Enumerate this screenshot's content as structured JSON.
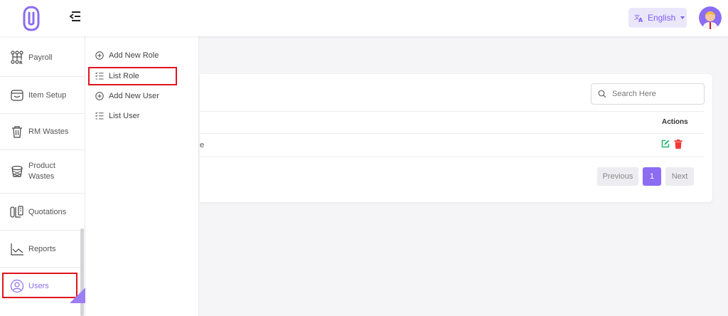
{
  "header": {
    "language": "English"
  },
  "sidebar": {
    "items": [
      {
        "label": "Payroll",
        "icon": "payroll-icon"
      },
      {
        "label": "Item Setup",
        "icon": "item-setup-icon"
      },
      {
        "label": "RM Wastes",
        "icon": "trash-icon"
      },
      {
        "label": "Product Wastes",
        "icon": "basket-icon"
      },
      {
        "label": "Quotations",
        "icon": "quotations-icon"
      },
      {
        "label": "Reports",
        "icon": "chart-icon"
      },
      {
        "label": "Users",
        "icon": "user-icon"
      }
    ]
  },
  "submenu": {
    "items": [
      {
        "label": "Add New Role",
        "icon": "plus-circle-icon"
      },
      {
        "label": "List Role",
        "icon": "list-icon"
      },
      {
        "label": "Add New User",
        "icon": "plus-circle-icon"
      },
      {
        "label": "List User",
        "icon": "list-icon"
      }
    ]
  },
  "table": {
    "search_placeholder": "Search Here",
    "actions_header": "Actions",
    "row_fragment": "e"
  },
  "pagination": {
    "previous": "Previous",
    "current": "1",
    "next": "Next"
  },
  "colors": {
    "accent": "#8b6cf2",
    "highlight_box": "#e0141e",
    "edit": "#22b573",
    "delete": "#f03a3a"
  }
}
